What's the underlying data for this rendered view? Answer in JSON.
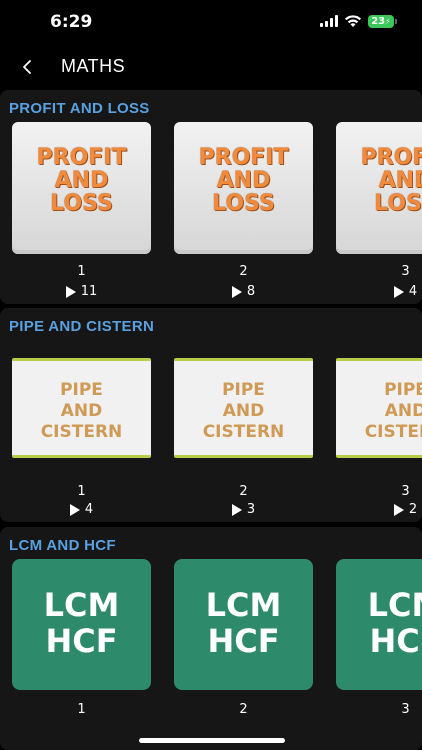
{
  "status": {
    "time": "6:29",
    "battery": "23"
  },
  "nav": {
    "title": "MATHS"
  },
  "sections": [
    {
      "title": "PROFIT AND LOSS",
      "cards": [
        {
          "thumb_lines": [
            "PROFIT",
            "AND",
            "LOSS"
          ],
          "number": "1",
          "plays": "11"
        },
        {
          "thumb_lines": [
            "PROFIT",
            "AND",
            "LOSS"
          ],
          "number": "2",
          "plays": "8"
        },
        {
          "thumb_lines": [
            "PROFIT",
            "AND",
            "LOSS"
          ],
          "number": "3",
          "plays": "4"
        }
      ]
    },
    {
      "title": "PIPE AND CISTERN",
      "cards": [
        {
          "thumb_lines": [
            "PIPE",
            "AND",
            "CISTERN"
          ],
          "number": "1",
          "plays": "4"
        },
        {
          "thumb_lines": [
            "PIPE",
            "AND",
            "CISTERN"
          ],
          "number": "2",
          "plays": "3"
        },
        {
          "thumb_lines": [
            "PIPE",
            "AND",
            "CISTERN"
          ],
          "number": "3",
          "plays": "2"
        }
      ]
    },
    {
      "title": "LCM AND HCF",
      "cards": [
        {
          "thumb_lines": [
            "LCM",
            "HCF"
          ],
          "number": "1"
        },
        {
          "thumb_lines": [
            "LCM",
            "HCF"
          ],
          "number": "2"
        },
        {
          "thumb_lines": [
            "LCM",
            "HCF"
          ],
          "number": "3"
        }
      ]
    }
  ]
}
